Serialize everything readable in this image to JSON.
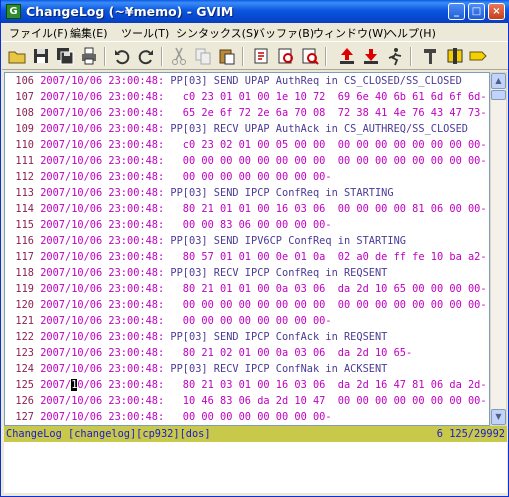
{
  "window": {
    "title": "ChangeLog (~¥memo) - GVIM",
    "icon_letter": "G"
  },
  "titlebar_buttons": {
    "minimize": "_",
    "maximize": "□",
    "close": "×"
  },
  "menu": [
    {
      "label": "ファイル(F)"
    },
    {
      "label": "編集(E)"
    },
    {
      "label": "ツール(T)"
    },
    {
      "label": "シンタックス(S)"
    },
    {
      "label": "バッファ(B)"
    },
    {
      "label": "ウィンドウ(W)"
    },
    {
      "label": "ヘルプ(H)"
    }
  ],
  "toolbar": [
    "open-icon",
    "save-icon",
    "save-all-icon",
    "print-icon",
    "undo-icon",
    "redo-icon",
    "cut-icon",
    "copy-icon",
    "paste-icon",
    "replace-icon",
    "find-next-icon",
    "find-prev-icon",
    "load-session-icon",
    "save-session-icon",
    "run-script-icon",
    "make-icon",
    "shell-icon",
    "tag-icon"
  ],
  "lines": [
    {
      "n": "106",
      "ts": "2007/10/06 23:00:48:",
      "body": " PP[03] SEND UPAP AuthReq in CS_CLOSED/SS_CLOSED",
      "kind": "pp"
    },
    {
      "n": "107",
      "ts": "2007/10/06 23:00:48:",
      "body": "   c0 23 01 01 00 1e 10 72  69 6e 40 6b 61 6d 6f 6d-",
      "kind": "hex"
    },
    {
      "n": "108",
      "ts": "2007/10/06 23:00:48:",
      "body": "   65 2e 6f 72 2e 6a 70 08  72 38 41 4e 76 43 47 73-",
      "kind": "hex"
    },
    {
      "n": "109",
      "ts": "2007/10/06 23:00:48:",
      "body": " PP[03] RECV UPAP AuthAck in CS_AUTHREQ/SS_CLOSED",
      "kind": "pp"
    },
    {
      "n": "110",
      "ts": "2007/10/06 23:00:48:",
      "body": "   c0 23 02 01 00 05 00 00  00 00 00 00 00 00 00 00-",
      "kind": "hex"
    },
    {
      "n": "111",
      "ts": "2007/10/06 23:00:48:",
      "body": "   00 00 00 00 00 00 00 00  00 00 00 00 00 00 00 00-",
      "kind": "hex"
    },
    {
      "n": "112",
      "ts": "2007/10/06 23:00:48:",
      "body": "   00 00 00 00 00 00 00 00-",
      "kind": "hex"
    },
    {
      "n": "113",
      "ts": "2007/10/06 23:00:48:",
      "body": " PP[03] SEND IPCP ConfReq in STARTING",
      "kind": "pp"
    },
    {
      "n": "114",
      "ts": "2007/10/06 23:00:48:",
      "body": "   80 21 01 01 00 16 03 06  00 00 00 00 81 06 00 00-",
      "kind": "hex"
    },
    {
      "n": "115",
      "ts": "2007/10/06 23:00:48:",
      "body": "   00 00 83 06 00 00 00 00-",
      "kind": "hex"
    },
    {
      "n": "116",
      "ts": "2007/10/06 23:00:48:",
      "body": " PP[03] SEND IPV6CP ConfReq in STARTING",
      "kind": "pp"
    },
    {
      "n": "117",
      "ts": "2007/10/06 23:00:48:",
      "body": "   80 57 01 01 00 0e 01 0a  02 a0 de ff fe 10 ba a2-",
      "kind": "hex"
    },
    {
      "n": "118",
      "ts": "2007/10/06 23:00:48:",
      "body": " PP[03] RECV IPCP ConfReq in REQSENT",
      "kind": "pp"
    },
    {
      "n": "119",
      "ts": "2007/10/06 23:00:48:",
      "body": "   80 21 01 01 00 0a 03 06  da 2d 10 65 00 00 00 00-",
      "kind": "hex"
    },
    {
      "n": "120",
      "ts": "2007/10/06 23:00:48:",
      "body": "   00 00 00 00 00 00 00 00  00 00 00 00 00 00 00 00-",
      "kind": "hex"
    },
    {
      "n": "121",
      "ts": "2007/10/06 23:00:48:",
      "body": "   00 00 00 00 00 00 00 00-",
      "kind": "hex"
    },
    {
      "n": "122",
      "ts": "2007/10/06 23:00:48:",
      "body": " PP[03] SEND IPCP ConfAck in REQSENT",
      "kind": "pp"
    },
    {
      "n": "123",
      "ts": "2007/10/06 23:00:48:",
      "body": "   80 21 02 01 00 0a 03 06  da 2d 10 65-",
      "kind": "hex"
    },
    {
      "n": "124",
      "ts": "2007/10/06 23:00:48:",
      "body": " PP[03] RECV IPCP ConfNak in ACKSENT",
      "kind": "pp"
    },
    {
      "n": "125",
      "ts_pre": "2007/",
      "ts_cursor": "1",
      "ts_post": "0/06 23:00:48:",
      "body": "   80 21 03 01 00 16 03 06  da 2d 16 47 81 06 da 2d-",
      "kind": "hex",
      "cursor": true
    },
    {
      "n": "126",
      "ts": "2007/10/06 23:00:48:",
      "body": "   10 46 83 06 da 2d 10 47  00 00 00 00 00 00 00 00-",
      "kind": "hex"
    },
    {
      "n": "127",
      "ts": "2007/10/06 23:00:48:",
      "body": "   00 00 00 00 00 00 00 00-",
      "kind": "hex"
    }
  ],
  "status": {
    "left": "ChangeLog [changelog][cp932][dos]",
    "right": "6 125/29992"
  },
  "colors": {
    "status_bg": "#c8c84a",
    "line_number": "#8b2252",
    "timestamp": "#c000c0",
    "pp_text": "#4b3b93"
  }
}
